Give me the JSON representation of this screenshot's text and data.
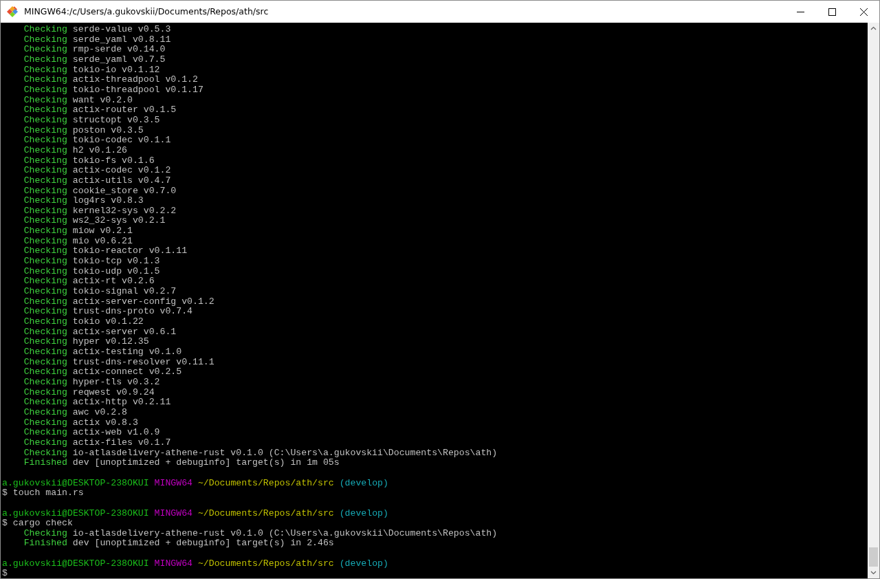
{
  "window": {
    "title": "MINGW64:/c/Users/a.gukovskii/Documents/Repos/ath/src"
  },
  "terminal": {
    "lines": [
      {
        "kind": "status",
        "status": "Checking",
        "text": "serde-value v0.5.3"
      },
      {
        "kind": "status",
        "status": "Checking",
        "text": "serde_yaml v0.8.11"
      },
      {
        "kind": "status",
        "status": "Checking",
        "text": "rmp-serde v0.14.0"
      },
      {
        "kind": "status",
        "status": "Checking",
        "text": "serde_yaml v0.7.5"
      },
      {
        "kind": "status",
        "status": "Checking",
        "text": "tokio-io v0.1.12"
      },
      {
        "kind": "status",
        "status": "Checking",
        "text": "actix-threadpool v0.1.2"
      },
      {
        "kind": "status",
        "status": "Checking",
        "text": "tokio-threadpool v0.1.17"
      },
      {
        "kind": "status",
        "status": "Checking",
        "text": "want v0.2.0"
      },
      {
        "kind": "status",
        "status": "Checking",
        "text": "actix-router v0.1.5"
      },
      {
        "kind": "status",
        "status": "Checking",
        "text": "structopt v0.3.5"
      },
      {
        "kind": "status",
        "status": "Checking",
        "text": "poston v0.3.5"
      },
      {
        "kind": "status",
        "status": "Checking",
        "text": "tokio-codec v0.1.1"
      },
      {
        "kind": "status",
        "status": "Checking",
        "text": "h2 v0.1.26"
      },
      {
        "kind": "status",
        "status": "Checking",
        "text": "tokio-fs v0.1.6"
      },
      {
        "kind": "status",
        "status": "Checking",
        "text": "actix-codec v0.1.2"
      },
      {
        "kind": "status",
        "status": "Checking",
        "text": "actix-utils v0.4.7"
      },
      {
        "kind": "status",
        "status": "Checking",
        "text": "cookie_store v0.7.0"
      },
      {
        "kind": "status",
        "status": "Checking",
        "text": "log4rs v0.8.3"
      },
      {
        "kind": "status",
        "status": "Checking",
        "text": "kernel32-sys v0.2.2"
      },
      {
        "kind": "status",
        "status": "Checking",
        "text": "ws2_32-sys v0.2.1"
      },
      {
        "kind": "status",
        "status": "Checking",
        "text": "miow v0.2.1"
      },
      {
        "kind": "status",
        "status": "Checking",
        "text": "mio v0.6.21"
      },
      {
        "kind": "status",
        "status": "Checking",
        "text": "tokio-reactor v0.1.11"
      },
      {
        "kind": "status",
        "status": "Checking",
        "text": "tokio-tcp v0.1.3"
      },
      {
        "kind": "status",
        "status": "Checking",
        "text": "tokio-udp v0.1.5"
      },
      {
        "kind": "status",
        "status": "Checking",
        "text": "actix-rt v0.2.6"
      },
      {
        "kind": "status",
        "status": "Checking",
        "text": "tokio-signal v0.2.7"
      },
      {
        "kind": "status",
        "status": "Checking",
        "text": "actix-server-config v0.1.2"
      },
      {
        "kind": "status",
        "status": "Checking",
        "text": "trust-dns-proto v0.7.4"
      },
      {
        "kind": "status",
        "status": "Checking",
        "text": "tokio v0.1.22"
      },
      {
        "kind": "status",
        "status": "Checking",
        "text": "actix-server v0.6.1"
      },
      {
        "kind": "status",
        "status": "Checking",
        "text": "hyper v0.12.35"
      },
      {
        "kind": "status",
        "status": "Checking",
        "text": "actix-testing v0.1.0"
      },
      {
        "kind": "status",
        "status": "Checking",
        "text": "trust-dns-resolver v0.11.1"
      },
      {
        "kind": "status",
        "status": "Checking",
        "text": "actix-connect v0.2.5"
      },
      {
        "kind": "status",
        "status": "Checking",
        "text": "hyper-tls v0.3.2"
      },
      {
        "kind": "status",
        "status": "Checking",
        "text": "reqwest v0.9.24"
      },
      {
        "kind": "status",
        "status": "Checking",
        "text": "actix-http v0.2.11"
      },
      {
        "kind": "status",
        "status": "Checking",
        "text": "awc v0.2.8"
      },
      {
        "kind": "status",
        "status": "Checking",
        "text": "actix v0.8.3"
      },
      {
        "kind": "status",
        "status": "Checking",
        "text": "actix-web v1.0.9"
      },
      {
        "kind": "status",
        "status": "Checking",
        "text": "actix-files v0.1.7"
      },
      {
        "kind": "status",
        "status": "Checking",
        "text": "io-atlasdelivery-athene-rust v0.1.0 (C:\\Users\\a.gukovskii\\Documents\\Repos\\ath)"
      },
      {
        "kind": "status",
        "status": "Finished",
        "text": "dev [unoptimized + debuginfo] target(s) in 1m 05s"
      },
      {
        "kind": "blank"
      },
      {
        "kind": "prompt",
        "user_host": "a.gukovskii@DESKTOP-238OKUI",
        "system": "MINGW64",
        "path": "~/Documents/Repos/ath/src",
        "branch": "(develop)"
      },
      {
        "kind": "command",
        "text": "$ touch main.rs"
      },
      {
        "kind": "blank"
      },
      {
        "kind": "prompt",
        "user_host": "a.gukovskii@DESKTOP-238OKUI",
        "system": "MINGW64",
        "path": "~/Documents/Repos/ath/src",
        "branch": "(develop)"
      },
      {
        "kind": "command",
        "text": "$ cargo check"
      },
      {
        "kind": "status",
        "status": "Checking",
        "text": "io-atlasdelivery-athene-rust v0.1.0 (C:\\Users\\a.gukovskii\\Documents\\Repos\\ath)"
      },
      {
        "kind": "status",
        "status": "Finished",
        "text": "dev [unoptimized + debuginfo] target(s) in 2.46s"
      },
      {
        "kind": "blank"
      },
      {
        "kind": "prompt",
        "user_host": "a.gukovskii@DESKTOP-238OKUI",
        "system": "MINGW64",
        "path": "~/Documents/Repos/ath/src",
        "branch": "(develop)"
      },
      {
        "kind": "command",
        "text": "$"
      }
    ]
  }
}
